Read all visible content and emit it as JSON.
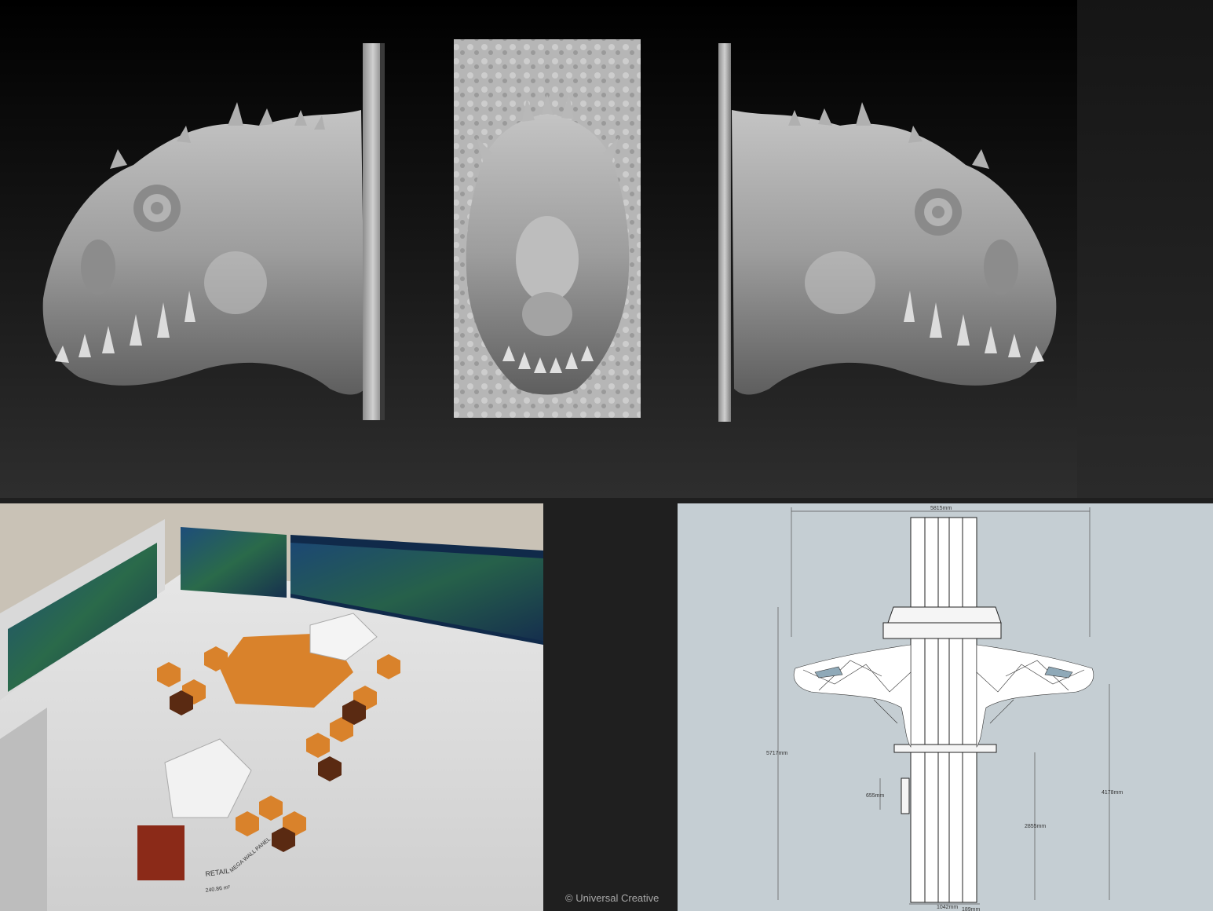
{
  "credit": "© Universal Creative",
  "drawing": {
    "dim_width_top": "5815mm",
    "dim_height_left": "5717mm",
    "dim_height_right": "4178mm",
    "dim_mid": "2855mm",
    "dim_small": "655mm",
    "dim_base": "1042mm",
    "dim_base_small": "189mm"
  },
  "photo": {
    "retail_label": "RETAIL",
    "wall_label": "MEGA WALL PANEL",
    "area_label": "240.86 m²"
  },
  "colors": {
    "sculpt_gray": "#9a9a9a",
    "hex_orange": "#d9822b",
    "hex_dark": "#5a2a12",
    "drawing_bg": "#c5ced3"
  }
}
